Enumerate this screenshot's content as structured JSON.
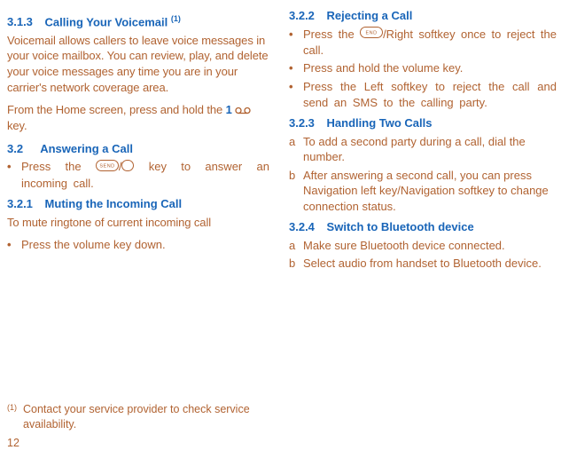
{
  "left": {
    "s313_num": "3.1.3",
    "s313_title": "Calling Your Voicemail",
    "s313_fn": "(1)",
    "s313_p1": "Voicemail allows callers to leave voice messages in your voice mailbox. You can review, play, and delete your voice messages any time you are in your carrier's network coverage area.",
    "s313_p2a": "From the Home screen, press and hold the ",
    "s313_p2_key": "1",
    "s313_p2b": " key.",
    "s32_num": "3.2",
    "s32_title": "Answering a Call",
    "s32_b1a": "Press the ",
    "s32_b1b": " key to answer an incoming call.",
    "s321_num": "3.2.1",
    "s321_title": "Muting the Incoming Call",
    "s321_p1": "To mute ringtone of current incoming call",
    "s321_b1": "Press the volume key down."
  },
  "right": {
    "s322_num": "3.2.2",
    "s322_title": "Rejecting a Call",
    "s322_b1a": "Press the ",
    "s322_b1b": "/Right softkey once to reject the call.",
    "s322_b2": "Press and hold the volume key.",
    "s322_b3": "Press the Left softkey to reject the call and send an SMS to the calling party.",
    "s323_num": "3.2.3",
    "s323_title": "Handling Two Calls",
    "s323_a": "To add a second party during a call, dial the number.",
    "s323_b": "After answering a second call, you can press Navigation left key/Navigation softkey to change connection status.",
    "s324_num": "3.2.4",
    "s324_title": "Switch to Bluetooth device",
    "s324_a": "Make sure Bluetooth device connected.",
    "s324_b": "Select audio from handset to Bluetooth device."
  },
  "footnote": {
    "num": "(1)",
    "text": "Contact your service provider to check service availability."
  },
  "pagenum": "12"
}
